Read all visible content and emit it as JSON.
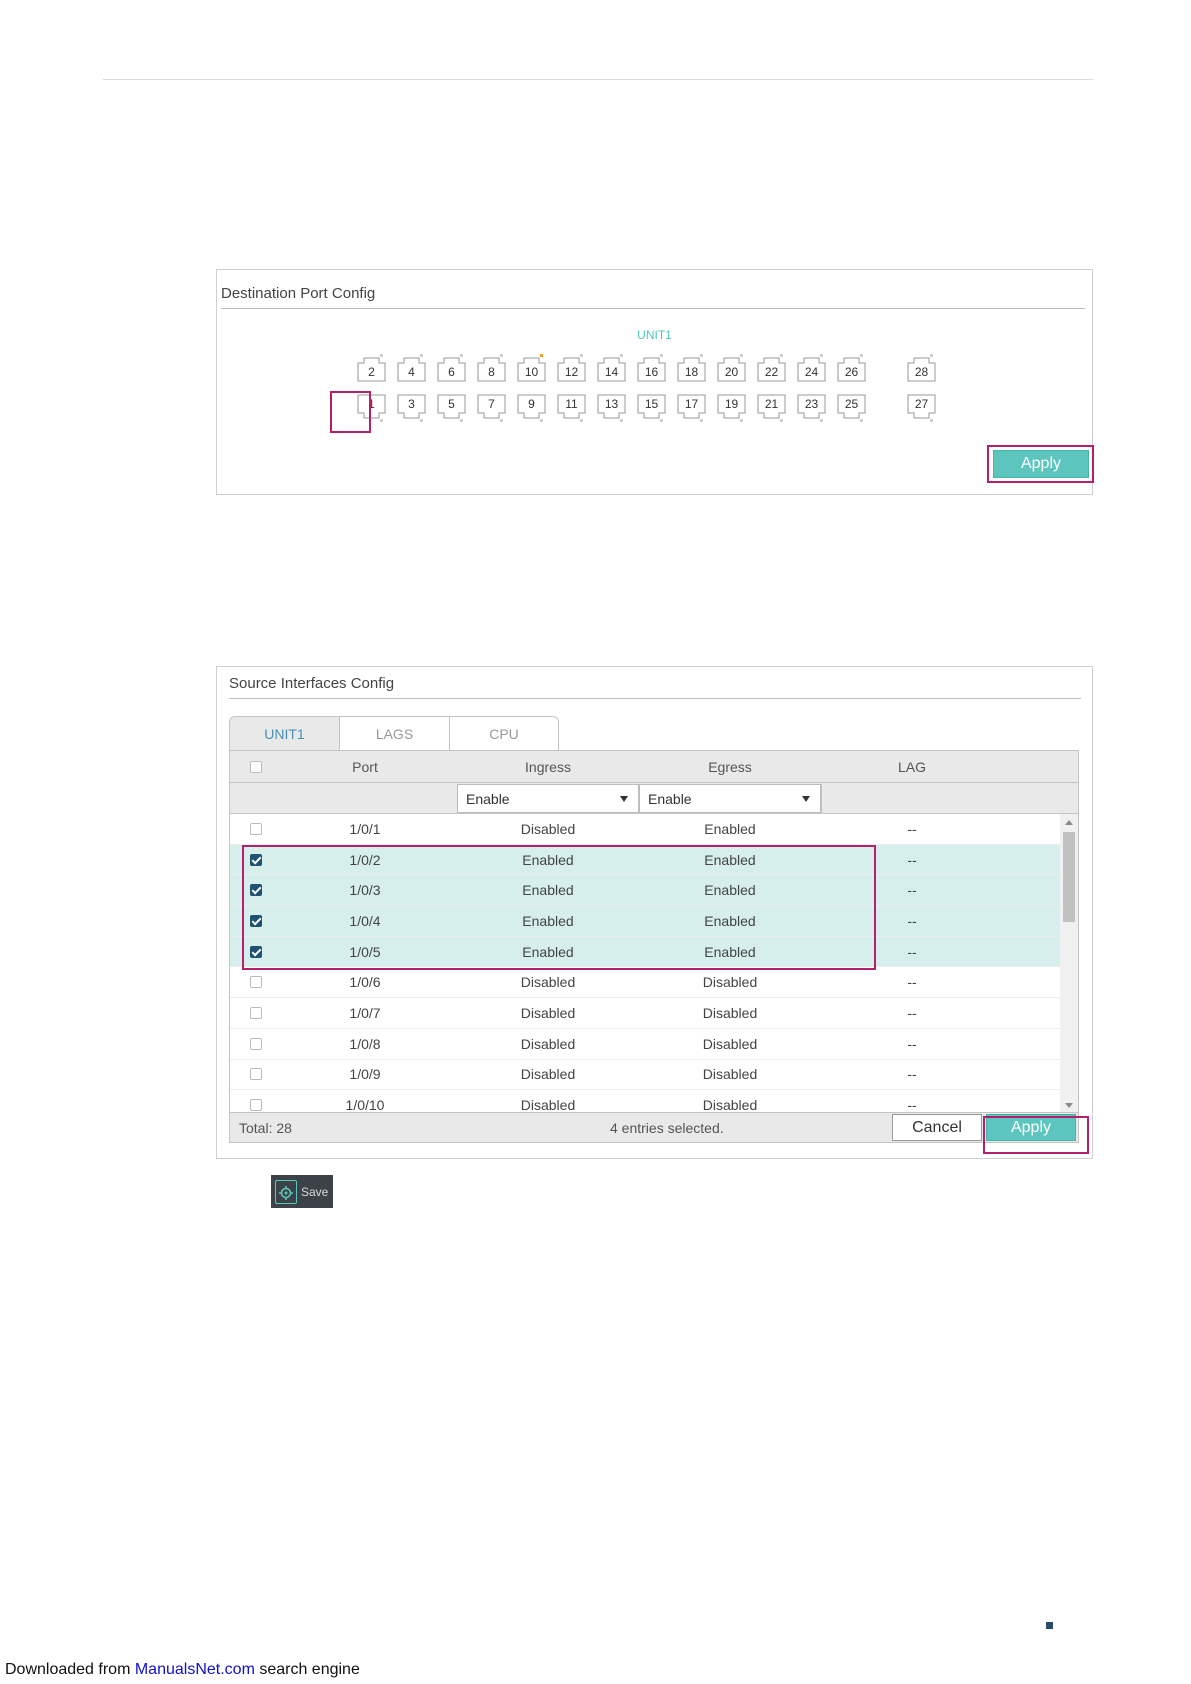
{
  "destination_panel": {
    "title": "Destination Port Config",
    "unit_label": "UNIT1",
    "top_ports": [
      "2",
      "4",
      "6",
      "8",
      "10",
      "12",
      "14",
      "16",
      "18",
      "20",
      "22",
      "24",
      "26",
      "28"
    ],
    "bottom_ports": [
      "1",
      "3",
      "5",
      "7",
      "9",
      "11",
      "13",
      "15",
      "17",
      "19",
      "21",
      "23",
      "25",
      "27"
    ],
    "selected_port": "1",
    "active_port_indicator": "10",
    "apply_label": "Apply"
  },
  "source_panel": {
    "title": "Source Interfaces Config",
    "tabs": [
      {
        "label": "UNIT1",
        "active": true
      },
      {
        "label": "LAGS",
        "active": false
      },
      {
        "label": "CPU",
        "active": false
      }
    ],
    "columns": {
      "port": "Port",
      "ingress": "Ingress",
      "egress": "Egress",
      "lag": "LAG"
    },
    "filters": {
      "ingress": "Enable",
      "egress": "Enable"
    },
    "rows": [
      {
        "port": "1/0/1",
        "ingress": "Disabled",
        "egress": "Enabled",
        "lag": "--",
        "checked": false
      },
      {
        "port": "1/0/2",
        "ingress": "Enabled",
        "egress": "Enabled",
        "lag": "--",
        "checked": true
      },
      {
        "port": "1/0/3",
        "ingress": "Enabled",
        "egress": "Enabled",
        "lag": "--",
        "checked": true
      },
      {
        "port": "1/0/4",
        "ingress": "Enabled",
        "egress": "Enabled",
        "lag": "--",
        "checked": true
      },
      {
        "port": "1/0/5",
        "ingress": "Enabled",
        "egress": "Enabled",
        "lag": "--",
        "checked": true
      },
      {
        "port": "1/0/6",
        "ingress": "Disabled",
        "egress": "Disabled",
        "lag": "--",
        "checked": false
      },
      {
        "port": "1/0/7",
        "ingress": "Disabled",
        "egress": "Disabled",
        "lag": "--",
        "checked": false
      },
      {
        "port": "1/0/8",
        "ingress": "Disabled",
        "egress": "Disabled",
        "lag": "--",
        "checked": false
      },
      {
        "port": "1/0/9",
        "ingress": "Disabled",
        "egress": "Disabled",
        "lag": "--",
        "checked": false
      },
      {
        "port": "1/0/10",
        "ingress": "Disabled",
        "egress": "Disabled",
        "lag": "--",
        "checked": false
      }
    ],
    "total": "Total: 28",
    "selection_status": "4 entries selected.",
    "cancel_label": "Cancel",
    "apply_label": "Apply"
  },
  "save_button": {
    "label": "Save",
    "icon": "gear-save-icon"
  },
  "credit": {
    "prefix": "Downloaded from ",
    "link": "ManualsNet.com",
    "suffix": " search engine"
  },
  "colors": {
    "accent": "#5cc6be",
    "highlight": "#b3206c",
    "selected_row": "#d7efec",
    "unit_label": "#4fc4bd",
    "checkbox_checked": "#1f5272"
  }
}
